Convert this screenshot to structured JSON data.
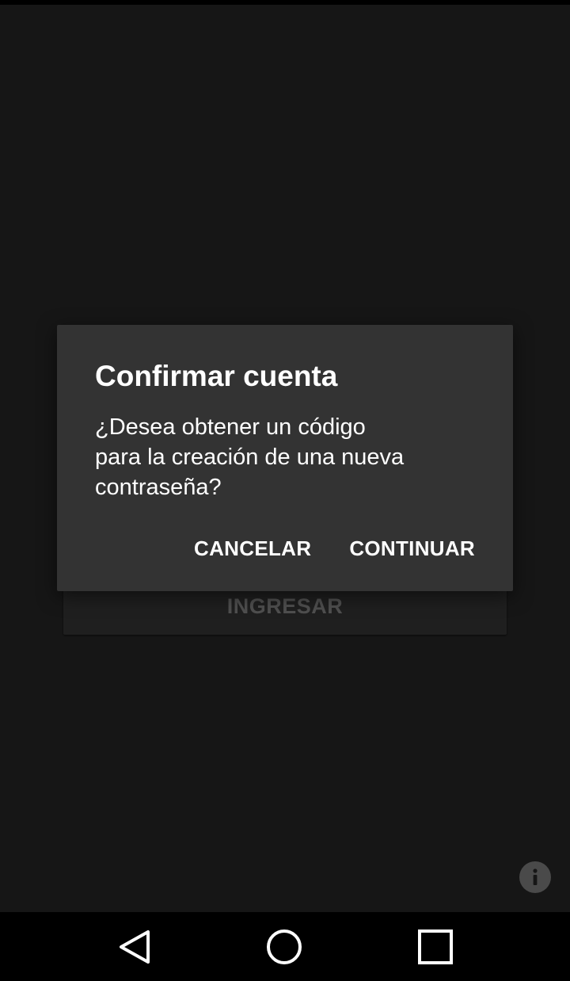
{
  "dialog": {
    "title": "Confirmar cuenta",
    "message": "¿Desea obtener un código\npara la creación de una nueva\ncontraseña?",
    "cancel_label": "CANCELAR",
    "continue_label": "CONTINUAR"
  },
  "login": {
    "button_label": "INGRESAR"
  },
  "icons": {
    "info": "info-icon",
    "back": "back-icon",
    "home": "home-icon",
    "recents": "recents-icon"
  },
  "colors": {
    "background": "#161616",
    "dialog_background": "#333333",
    "dialog_text": "#ffffff",
    "disabled_text": "#4f4f4f",
    "nav_bar": "#000000"
  }
}
